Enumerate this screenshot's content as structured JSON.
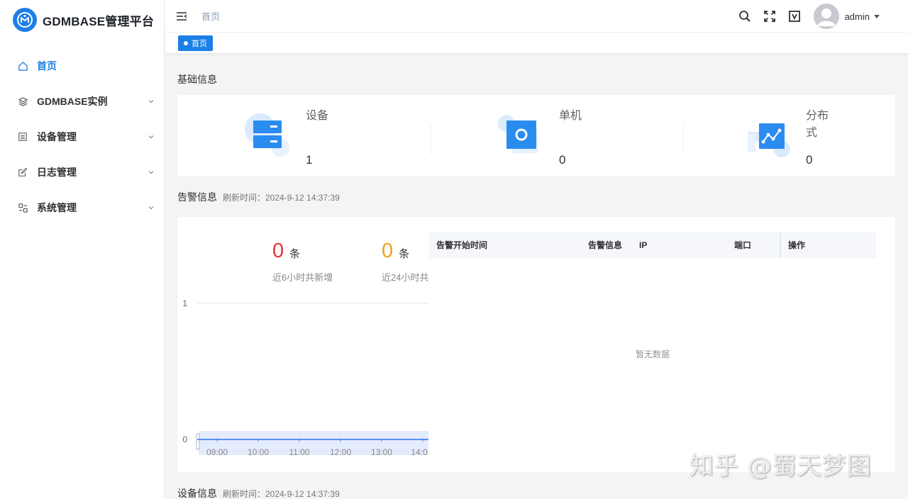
{
  "app": {
    "title": "GDMBASE管理平台"
  },
  "sidebar": {
    "items": [
      {
        "label": "首页",
        "icon": "home-icon",
        "active": true,
        "expandable": false
      },
      {
        "label": "GDMBASE实例",
        "icon": "layers-icon",
        "active": false,
        "expandable": true
      },
      {
        "label": "设备管理",
        "icon": "list-icon",
        "active": false,
        "expandable": true
      },
      {
        "label": "日志管理",
        "icon": "edit-icon",
        "active": false,
        "expandable": true
      },
      {
        "label": "系统管理",
        "icon": "settings-group-icon",
        "active": false,
        "expandable": true
      }
    ]
  },
  "header": {
    "breadcrumb": "首页",
    "user": "admin",
    "icons": [
      "search-icon",
      "fullscreen-icon",
      "theme-icon"
    ]
  },
  "tags": [
    {
      "label": "首页",
      "active": true
    }
  ],
  "basic": {
    "title": "基础信息",
    "stats": [
      {
        "label": "设备",
        "value": "1",
        "icon": "server-icon"
      },
      {
        "label": "单机",
        "value": "0",
        "icon": "standalone-icon"
      },
      {
        "label": "分布式",
        "value": "0",
        "icon": "distributed-icon"
      }
    ]
  },
  "alarm": {
    "title": "告警信息",
    "refresh": "刷新时间：2024-9-12 14:37:39",
    "counts": [
      {
        "value": "0",
        "unit": "条",
        "label": "近6小时共新增",
        "color": "#e8333b"
      },
      {
        "value": "0",
        "unit": "条",
        "label": "近24小时共",
        "color": "#f0a020"
      }
    ],
    "table": {
      "columns": [
        "告警开始时间",
        "告警信息",
        "IP",
        "端口",
        "操作"
      ],
      "empty_text": "暂无数据"
    }
  },
  "device_info": {
    "title": "设备信息",
    "refresh": "刷新时间：2024-9-12 14:37:39"
  },
  "chart_data": {
    "type": "line",
    "x": [
      "09:00",
      "10:00",
      "11:00",
      "12:00",
      "13:00",
      "14:0..."
    ],
    "series": [
      {
        "values": [
          0,
          0,
          0,
          0,
          0,
          0
        ]
      }
    ],
    "yticks": [
      "0",
      "1"
    ],
    "ylim": [
      0,
      1
    ],
    "grid": true,
    "color": "#5b8ff9"
  },
  "watermark": "知乎 @蜀天梦图",
  "colors": {
    "primary": "#1c7fe6",
    "danger": "#e8333b",
    "warning": "#f0a020"
  }
}
